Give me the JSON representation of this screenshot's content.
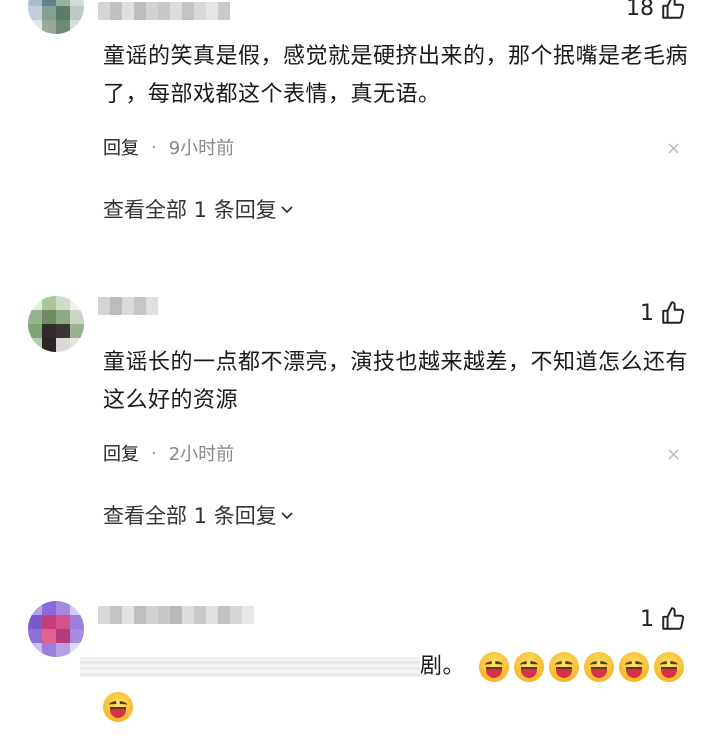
{
  "comments": [
    {
      "likes": "18",
      "text": "童谣的笑真是假，感觉就是硬挤出来的，那个抿嘴是老毛病了，每部戏都这个表情，真无语。",
      "reply_label": "回复",
      "separator": "·",
      "time": "9小时前",
      "view_all": "查看全部 1 条回复"
    },
    {
      "likes": "1",
      "text": "童谣长的一点都不漂亮，演技也越来越差，不知道怎么还有这么好的资源",
      "reply_label": "回复",
      "separator": "·",
      "time": "2小时前",
      "view_all": "查看全部 1 条回复"
    },
    {
      "likes": "1",
      "text_tail": "剧。"
    }
  ]
}
